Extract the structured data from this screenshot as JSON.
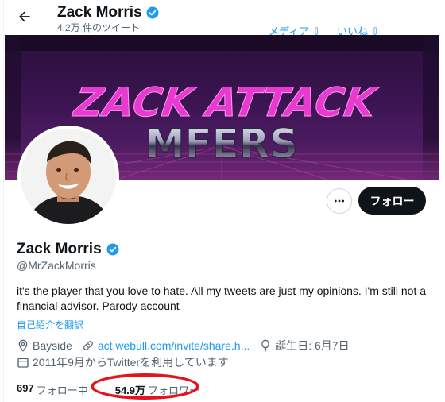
{
  "header": {
    "name": "Zack Morris",
    "tweet_count": "4.2万 件のツイート",
    "media_link": "メディア ⇩",
    "likes_link": "いいね ⇩"
  },
  "banner": {
    "line1": "ZACK ATTACK",
    "line2": "MFERS"
  },
  "actions": {
    "follow_label": "フォロー"
  },
  "profile": {
    "name": "Zack Morris",
    "handle": "@MrZackMorris",
    "bio": "it's the player that you love to hate. All my tweets are just my opinions. I'm still not a financial advisor. Parody account",
    "translate_label": "自己紹介を翻訳",
    "location": "Bayside",
    "website": "act.webull.com/invite/share.h...",
    "birthday": "誕生日: 6月7日",
    "joined": "2011年9月からTwitterを利用しています"
  },
  "stats": {
    "following_count": "697",
    "following_label": "フォロー中",
    "followers_count": "54.9万",
    "followers_label": "フォロワー"
  },
  "colors": {
    "accent": "#1d9bf0",
    "highlight_ring": "#e5141c",
    "banner_text": "#e83ad0"
  }
}
